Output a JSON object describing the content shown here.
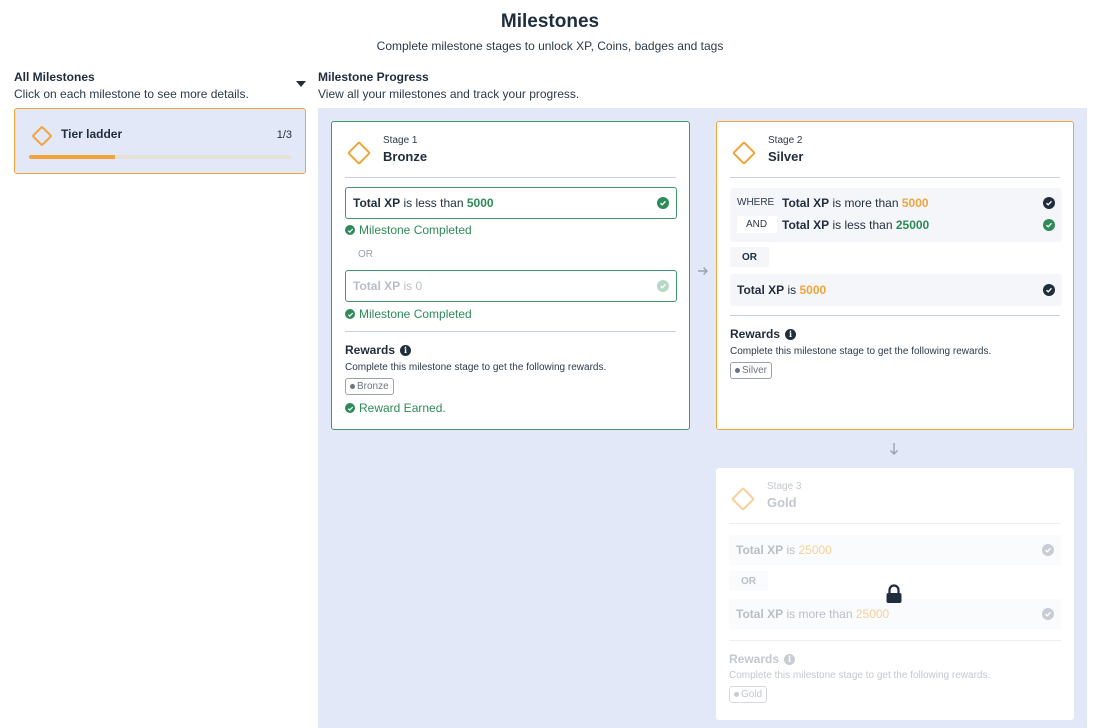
{
  "header": {
    "title": "Milestones",
    "subtitle": "Complete milestone stages to unlock XP, Coins, badges and tags"
  },
  "left": {
    "title": "All Milestones",
    "subtitle": "Click on each milestone to see more details.",
    "milestone": {
      "name": "Tier ladder",
      "count": "1/3",
      "progress_fraction": 0.33
    }
  },
  "right": {
    "title": "Milestone Progress",
    "subtitle": "View all your milestones and track your progress."
  },
  "stages": [
    {
      "number": "Stage 1",
      "name": "Bronze",
      "conditions": [
        {
          "label": "Total XP",
          "op": "is less than",
          "value": "5000",
          "completed_text": "Milestone Completed"
        },
        {
          "label": "Total XP",
          "op": "is",
          "value": "0",
          "completed_text": "Milestone Completed"
        }
      ],
      "or_label": "OR",
      "rewards_title": "Rewards",
      "rewards_sub": "Complete this milestone stage to get the following rewards.",
      "badge": "Bronze",
      "earned": "Reward Earned."
    },
    {
      "number": "Stage 2",
      "name": "Silver",
      "group": [
        {
          "op": "WHERE",
          "label": "Total XP",
          "rel": "is more than",
          "value": "5000"
        },
        {
          "op": "AND",
          "label": "Total XP",
          "rel": "is less than",
          "value": "25000"
        }
      ],
      "or_label": "OR",
      "cond": {
        "label": "Total XP",
        "rel": "is",
        "value": "5000"
      },
      "rewards_title": "Rewards",
      "rewards_sub": "Complete this milestone stage to get the following rewards.",
      "badge": "Silver"
    },
    {
      "number": "Stage 3",
      "name": "Gold",
      "conds": [
        {
          "label": "Total XP",
          "rel": "is",
          "value": "25000"
        },
        {
          "label": "Total XP",
          "rel": "is more than",
          "value": "25000"
        }
      ],
      "or_label": "OR",
      "rewards_title": "Rewards",
      "rewards_sub": "Complete this milestone stage to get the following rewards.",
      "badge": "Gold"
    }
  ],
  "icons": {
    "diamond": "diamond-icon",
    "check": "check-circle-icon",
    "info": "info-icon",
    "lock": "lock-icon",
    "arrow_right": "arrow-right-icon",
    "arrow_down": "arrow-down-icon",
    "caret": "caret-down-icon"
  },
  "colors": {
    "accent": "#f0a43a",
    "success": "#2e8b57",
    "panel": "#e3e8f8",
    "text": "#1f2d3d"
  }
}
